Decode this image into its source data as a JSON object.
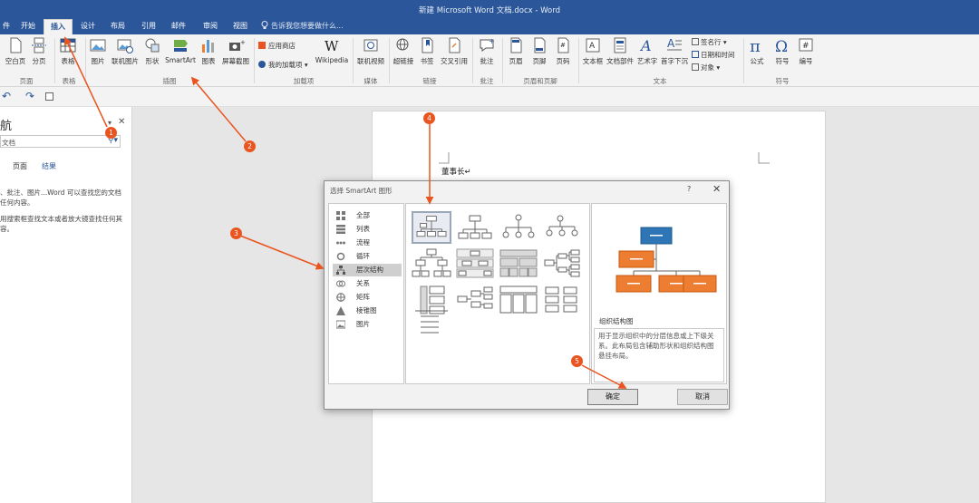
{
  "window": {
    "title": "新建 Microsoft Word 文档.docx - Word"
  },
  "tabs": [
    {
      "label": "件",
      "active": false
    },
    {
      "label": "开始",
      "active": false
    },
    {
      "label": "插入",
      "active": true
    },
    {
      "label": "设计",
      "active": false
    },
    {
      "label": "布局",
      "active": false
    },
    {
      "label": "引用",
      "active": false
    },
    {
      "label": "邮件",
      "active": false
    },
    {
      "label": "审阅",
      "active": false
    },
    {
      "label": "视图",
      "active": false
    }
  ],
  "tellme": "告诉我您想要做什么...",
  "ribbon": {
    "pages": {
      "cover": "空白页",
      "break": "分页",
      "group": "页面"
    },
    "tables": {
      "table": "表格",
      "group": "表格"
    },
    "illustrations": {
      "picture": "图片",
      "online_picture": "联机图片",
      "shapes": "形状",
      "smartart": "SmartArt",
      "chart": "图表",
      "screenshot": "屏幕截图",
      "group": "插图"
    },
    "addins": {
      "store": "应用商店",
      "my_addins": "我的加载项",
      "wikipedia": "Wikipedia",
      "group": "加载项"
    },
    "media": {
      "online_video": "联机视频",
      "group": "媒体"
    },
    "links": {
      "hyperlink": "超链接",
      "bookmark": "书签",
      "cross_ref": "交叉引用",
      "group": "链接"
    },
    "comments": {
      "comment": "批注",
      "group": "批注"
    },
    "header_footer": {
      "header": "页眉",
      "footer": "页脚",
      "page_number": "页码",
      "group": "页眉和页脚"
    },
    "text": {
      "textbox": "文本框",
      "quick_parts": "文档部件",
      "wordart": "艺术字",
      "dropcap": "首字下沉",
      "signature": "签名行",
      "datetime": "日期和时间",
      "object": "对象",
      "group": "文本"
    },
    "symbols": {
      "equation": "公式",
      "symbol": "符号",
      "number": "编号",
      "group": "符号"
    }
  },
  "nav_pane": {
    "title": "航",
    "search_value": "文档",
    "tabs": [
      {
        "label": "页面"
      },
      {
        "label": "结果"
      }
    ],
    "para1": "、批注、图片...Word 可以查找您的文档任何内容。",
    "para2": "用搜索框查找文本或者放大镜查找任何其容。"
  },
  "document": {
    "line1": "董事长↵"
  },
  "dialog": {
    "title": "选择 SmartArt 图形",
    "help": "?",
    "close": "✕",
    "categories": [
      {
        "label": "全部",
        "icon": "all-icon"
      },
      {
        "label": "列表",
        "icon": "list-icon"
      },
      {
        "label": "流程",
        "icon": "process-icon"
      },
      {
        "label": "循环",
        "icon": "cycle-icon"
      },
      {
        "label": "层次结构",
        "icon": "hierarchy-icon",
        "selected": true
      },
      {
        "label": "关系",
        "icon": "relationship-icon"
      },
      {
        "label": "矩阵",
        "icon": "matrix-icon"
      },
      {
        "label": "棱锥图",
        "icon": "pyramid-icon"
      },
      {
        "label": "图片",
        "icon": "picture-icon"
      }
    ],
    "preview_name": "组织结构图",
    "preview_desc": "用于显示组织中的分层信息或上下级关系。此布局包含辅助形状和组织结构图悬挂布局。",
    "ok": "确定",
    "cancel": "取消"
  },
  "annotations": [
    "1",
    "2",
    "3",
    "4",
    "5"
  ],
  "colors": {
    "accent": "#2b579a",
    "marker": "#e9541f",
    "preview_top": "#2e75b6",
    "preview_child": "#ed7d31"
  }
}
